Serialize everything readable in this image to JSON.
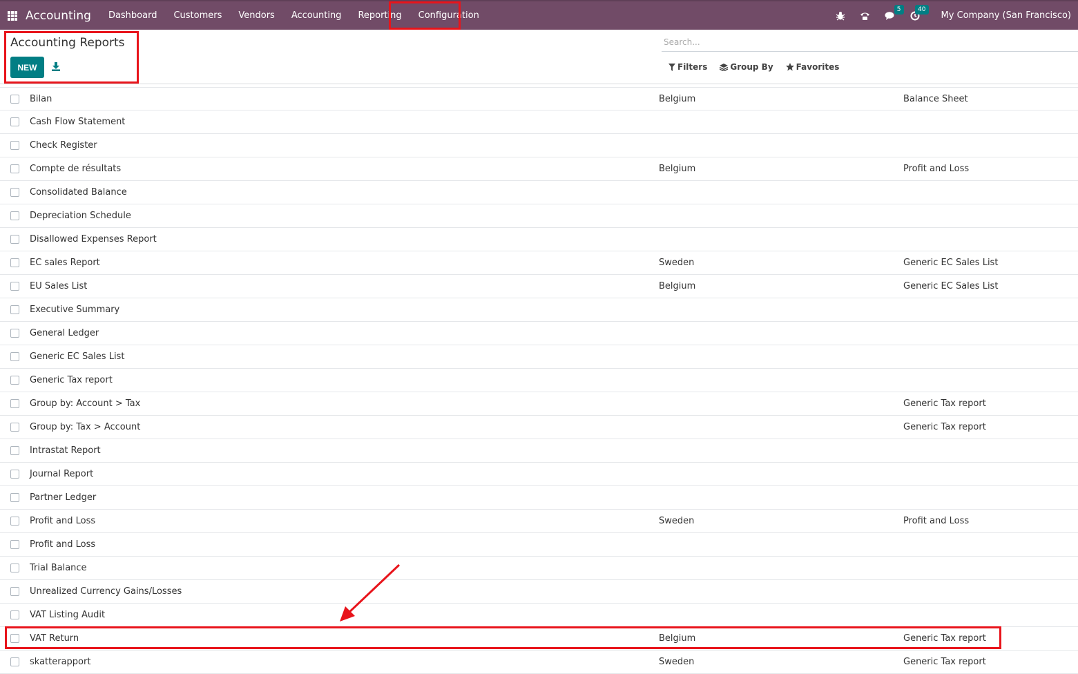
{
  "navbar": {
    "app_name": "Accounting",
    "menu": [
      "Dashboard",
      "Customers",
      "Vendors",
      "Accounting",
      "Reporting",
      "Configuration"
    ],
    "chat_count": "5",
    "activity_count": "40",
    "company": "My Company (San Francisco)",
    "icons": [
      "apps-grid-icon",
      "bug-icon",
      "phone-icon",
      "chat-icon",
      "clock-icon"
    ],
    "bg_color": "#714b67"
  },
  "control_panel": {
    "title": "Accounting Reports",
    "new_label": "NEW",
    "search_placeholder": "Search...",
    "filters_label": "Filters",
    "group_by_label": "Group By",
    "favorites_label": "Favorites",
    "accent_color": "#017e84"
  },
  "rows": [
    {
      "name": "Bilan",
      "country": "Belgium",
      "root": "Balance Sheet"
    },
    {
      "name": "Cash Flow Statement",
      "country": "",
      "root": ""
    },
    {
      "name": "Check Register",
      "country": "",
      "root": ""
    },
    {
      "name": "Compte de résultats",
      "country": "Belgium",
      "root": "Profit and Loss"
    },
    {
      "name": "Consolidated Balance",
      "country": "",
      "root": ""
    },
    {
      "name": "Depreciation Schedule",
      "country": "",
      "root": ""
    },
    {
      "name": "Disallowed Expenses Report",
      "country": "",
      "root": ""
    },
    {
      "name": "EC sales Report",
      "country": "Sweden",
      "root": "Generic EC Sales List"
    },
    {
      "name": "EU Sales List",
      "country": "Belgium",
      "root": "Generic EC Sales List"
    },
    {
      "name": "Executive Summary",
      "country": "",
      "root": ""
    },
    {
      "name": "General Ledger",
      "country": "",
      "root": ""
    },
    {
      "name": "Generic EC Sales List",
      "country": "",
      "root": ""
    },
    {
      "name": "Generic Tax report",
      "country": "",
      "root": ""
    },
    {
      "name": "Group by: Account > Tax",
      "country": "",
      "root": "Generic Tax report"
    },
    {
      "name": "Group by: Tax > Account",
      "country": "",
      "root": "Generic Tax report"
    },
    {
      "name": "Intrastat Report",
      "country": "",
      "root": ""
    },
    {
      "name": "Journal Report",
      "country": "",
      "root": ""
    },
    {
      "name": "Partner Ledger",
      "country": "",
      "root": ""
    },
    {
      "name": "Profit and Loss",
      "country": "Sweden",
      "root": "Profit and Loss"
    },
    {
      "name": "Profit and Loss",
      "country": "",
      "root": ""
    },
    {
      "name": "Trial Balance",
      "country": "",
      "root": ""
    },
    {
      "name": "Unrealized Currency Gains/Losses",
      "country": "",
      "root": ""
    },
    {
      "name": "VAT Listing Audit",
      "country": "",
      "root": ""
    },
    {
      "name": "VAT Return",
      "country": "Belgium",
      "root": "Generic Tax report"
    },
    {
      "name": "skatterapport",
      "country": "Sweden",
      "root": "Generic Tax report"
    }
  ],
  "annotation_color": "#e8141b"
}
